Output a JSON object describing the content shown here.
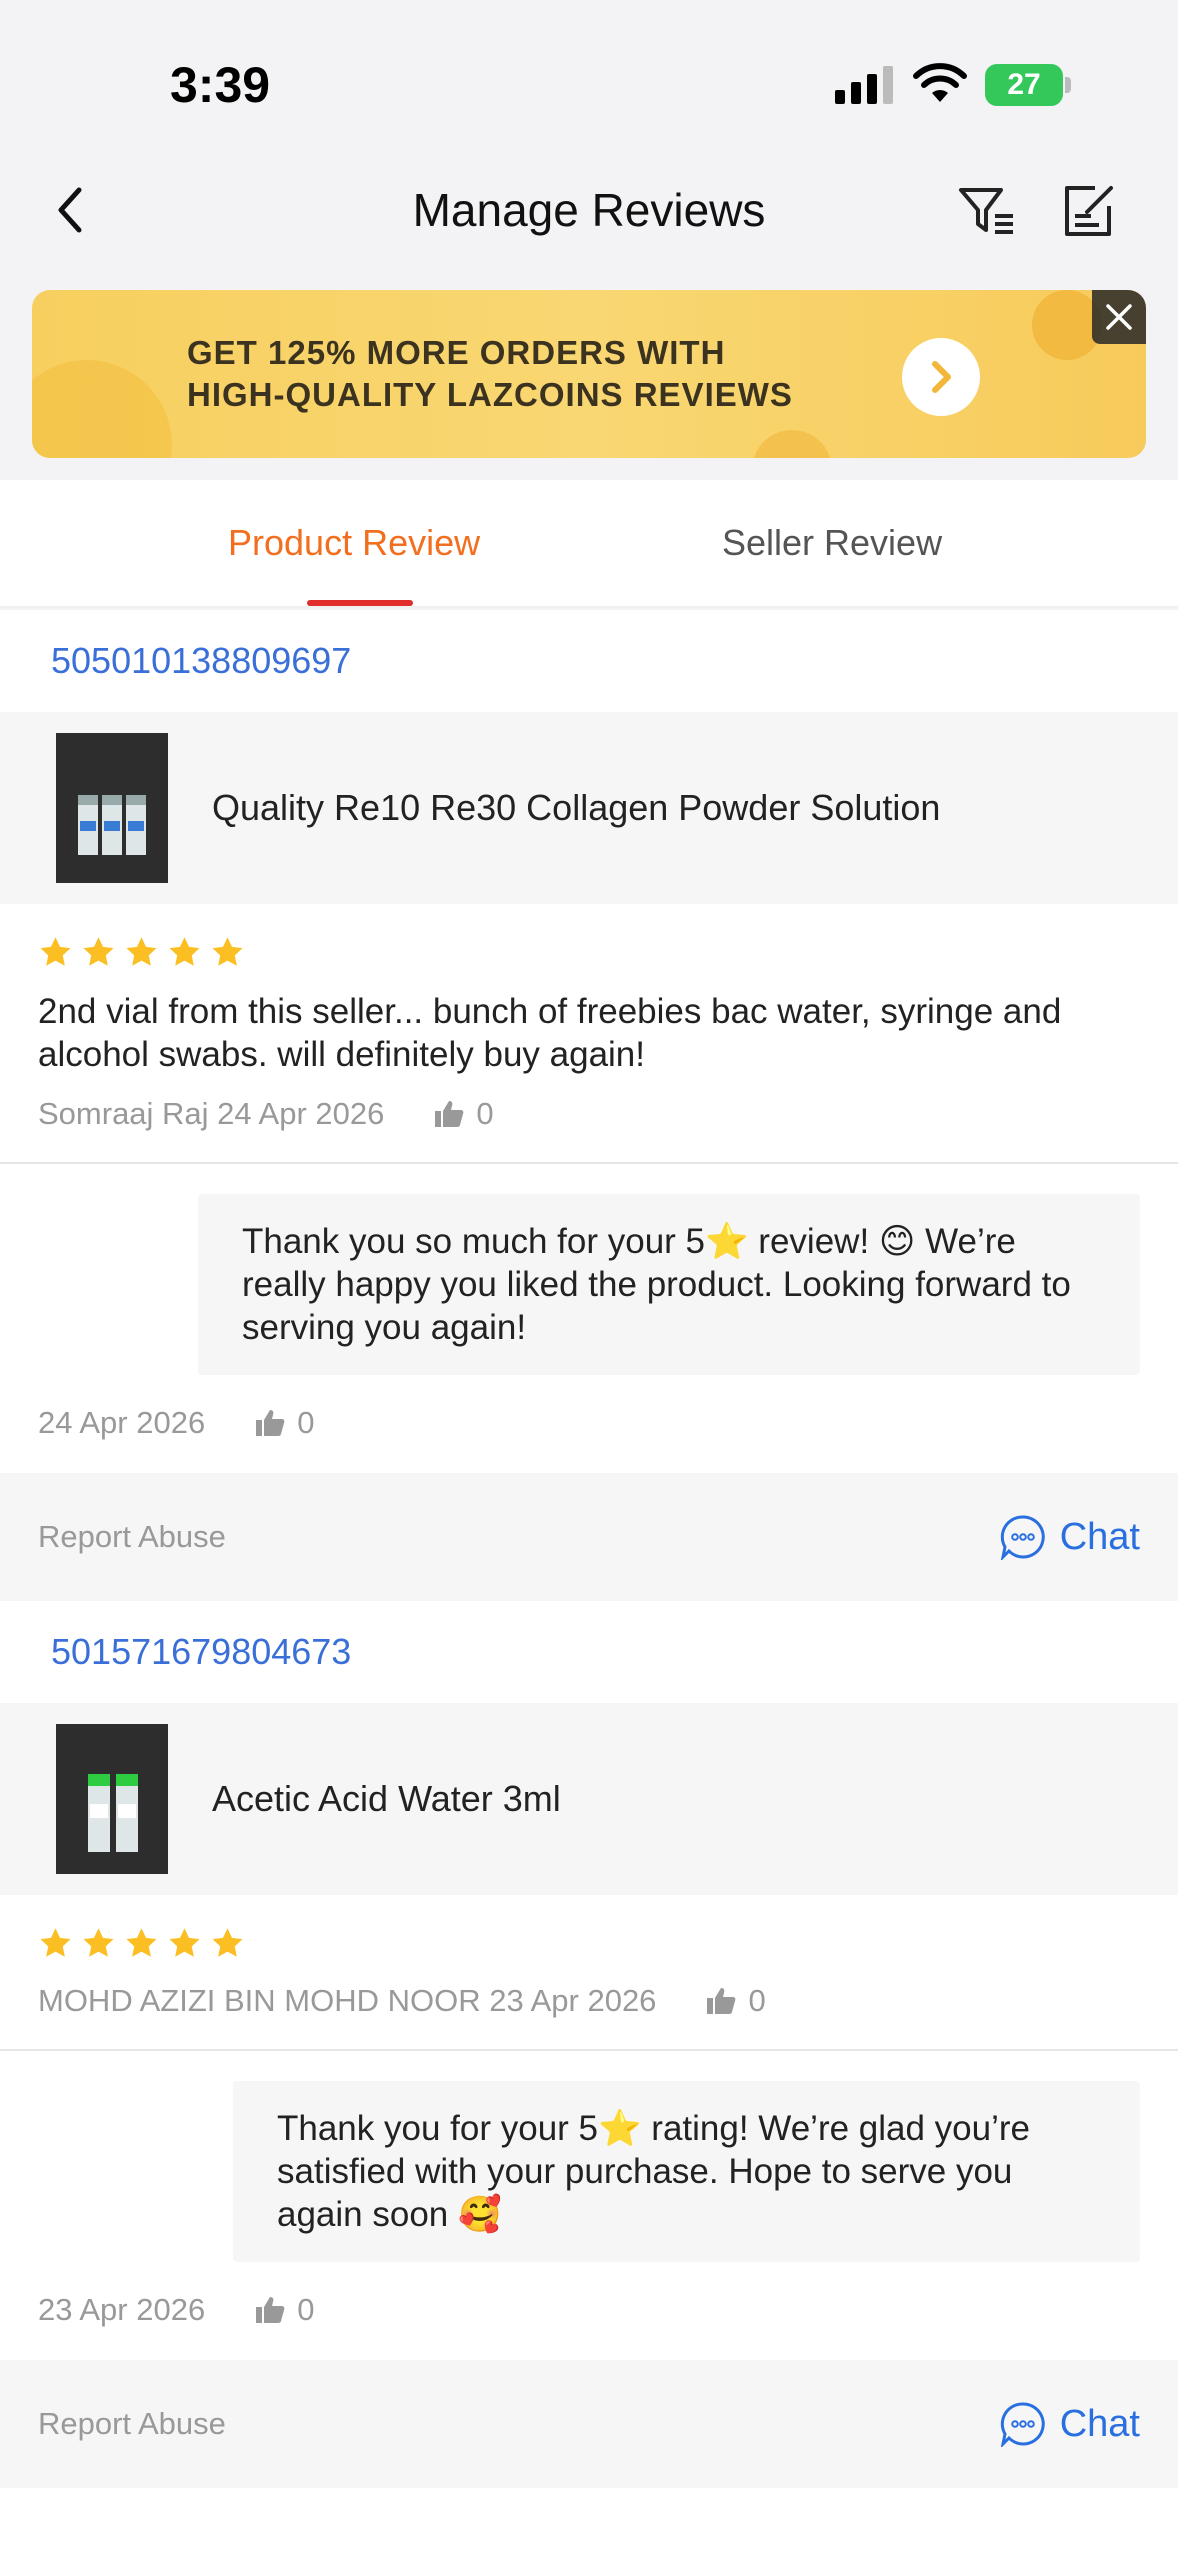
{
  "status_bar": {
    "time": "3:39",
    "battery": "27"
  },
  "header": {
    "title": "Manage Reviews"
  },
  "banner": {
    "line1": "GET 125% MORE ORDERS WITH",
    "line2": "HIGH-QUALITY LAZCOINS REVIEWS"
  },
  "tabs": [
    {
      "label": "Product Review",
      "active": true
    },
    {
      "label": "Seller Review",
      "active": false
    }
  ],
  "reviews": [
    {
      "order_id": "505010138809697",
      "product_name": "Quality Re10 Re30 Collagen Powder Solution",
      "rating": 5,
      "text": "2nd vial from this seller... bunch of freebies bac water, syringe and alcohol swabs. will definitely buy again!",
      "reviewer_date": "Somraaj Raj 24 Apr 2026",
      "likes": "0",
      "reply": "Thank you so much for your 5⭐ review! 😊 We’re really happy you liked the product. Looking forward to serving you again!",
      "reply_date": "24 Apr 2026",
      "reply_likes": "0",
      "report_label": "Report Abuse",
      "chat_label": "Chat"
    },
    {
      "order_id": "501571679804673",
      "product_name": "Acetic Acid Water 3ml",
      "rating": 5,
      "text": "",
      "reviewer_date": "MOHD AZIZI BIN MOHD NOOR 23 Apr 2026",
      "likes": "0",
      "reply": "Thank you for your 5⭐ rating! We’re glad you’re satisfied with your purchase. Hope to serve you again soon 🥰",
      "reply_date": "23 Apr 2026",
      "reply_likes": "0",
      "report_label": "Report Abuse",
      "chat_label": "Chat"
    }
  ],
  "colors": {
    "accent": "#f36f20",
    "link": "#3a6fd8",
    "star": "#fbbf24",
    "tab_underline": "#e12c2c"
  }
}
